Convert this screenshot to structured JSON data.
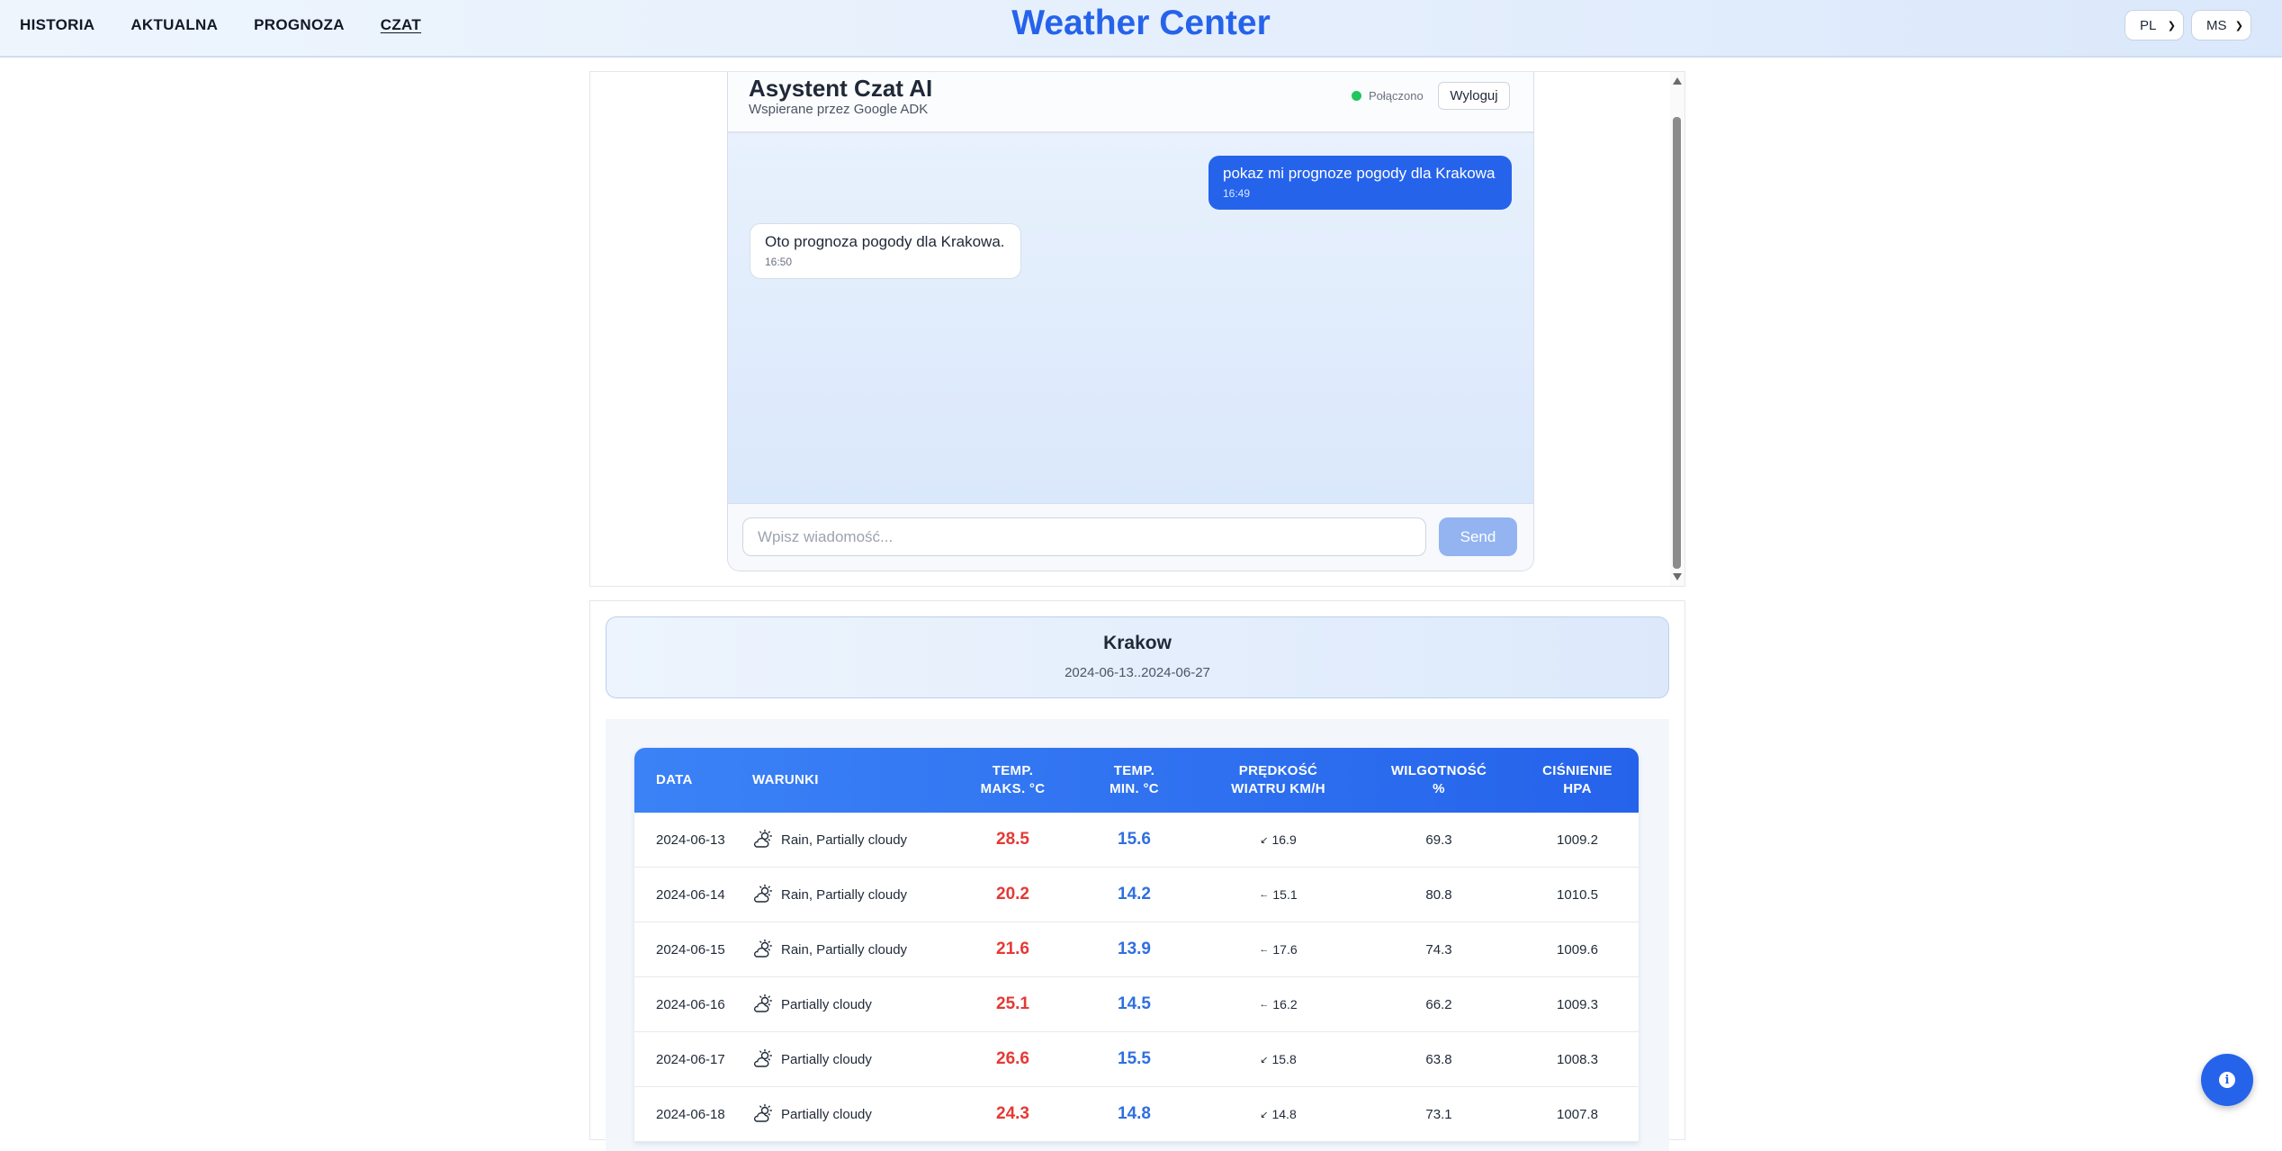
{
  "nav": {
    "items": [
      {
        "label": "HISTORIA",
        "active": false
      },
      {
        "label": "AKTUALNA",
        "active": false
      },
      {
        "label": "PROGNOZA",
        "active": false
      },
      {
        "label": "CZAT",
        "active": true
      }
    ]
  },
  "brand": {
    "title": "Weather Center",
    "color": "#2563eb"
  },
  "selects": {
    "language": "PL",
    "units": "MS"
  },
  "chat": {
    "title": "Asystent Czat AI",
    "subtitle": "Wspierane przez Google ADK",
    "status": "Połączono",
    "logout_label": "Wyloguj",
    "messages": [
      {
        "role": "user",
        "text": "pokaz mi prognoze pogody dla Krakowa",
        "time": "16:49"
      },
      {
        "role": "assistant",
        "text": "Oto prognoza pogody dla Krakowa.",
        "time": "16:50"
      }
    ],
    "input_placeholder": "Wpisz wiadomość...",
    "send_label": "Send"
  },
  "forecast": {
    "city": "Krakow",
    "range": "2024-06-13..2024-06-27",
    "headers": {
      "date": "DATA",
      "conditions": "WARUNKI",
      "tmax": "TEMP.\nMAKS. °C",
      "tmin": "TEMP.\nMIN. °C",
      "wind": "PRĘDKOŚĆ\nWIATRU KM/H",
      "humidity": "WILGOTNOŚĆ\n%",
      "pressure": "CIŚNIENIE\nHPA"
    },
    "rows": [
      {
        "date": "2024-06-13",
        "icon": "partly-cloudy-day-icon",
        "conditions": "Rain, Partially cloudy",
        "tmax": "28.5",
        "tmin": "15.6",
        "wind_arrow": "↙",
        "wind": "16.9",
        "humidity": "69.3",
        "pressure": "1009.2"
      },
      {
        "date": "2024-06-14",
        "icon": "partly-cloudy-day-icon",
        "conditions": "Rain, Partially cloudy",
        "tmax": "20.2",
        "tmin": "14.2",
        "wind_arrow": "←",
        "wind": "15.1",
        "humidity": "80.8",
        "pressure": "1010.5"
      },
      {
        "date": "2024-06-15",
        "icon": "partly-cloudy-day-icon",
        "conditions": "Rain, Partially cloudy",
        "tmax": "21.6",
        "tmin": "13.9",
        "wind_arrow": "←",
        "wind": "17.6",
        "humidity": "74.3",
        "pressure": "1009.6"
      },
      {
        "date": "2024-06-16",
        "icon": "partly-cloudy-day-icon",
        "conditions": "Partially cloudy",
        "tmax": "25.1",
        "tmin": "14.5",
        "wind_arrow": "←",
        "wind": "16.2",
        "humidity": "66.2",
        "pressure": "1009.3"
      },
      {
        "date": "2024-06-17",
        "icon": "partly-cloudy-day-icon",
        "conditions": "Partially cloudy",
        "tmax": "26.6",
        "tmin": "15.5",
        "wind_arrow": "↙",
        "wind": "15.8",
        "humidity": "63.8",
        "pressure": "1008.3"
      },
      {
        "date": "2024-06-18",
        "icon": "partly-cloudy-day-icon",
        "conditions": "Partially cloudy",
        "tmax": "24.3",
        "tmin": "14.8",
        "wind_arrow": "↙",
        "wind": "14.8",
        "humidity": "73.1",
        "pressure": "1007.8"
      }
    ]
  },
  "fab": {
    "icon": "info-icon"
  },
  "colors": {
    "accent": "#2563eb",
    "tmax": "#e53935",
    "tmin": "#2f6fe0",
    "online": "#22c55e"
  }
}
